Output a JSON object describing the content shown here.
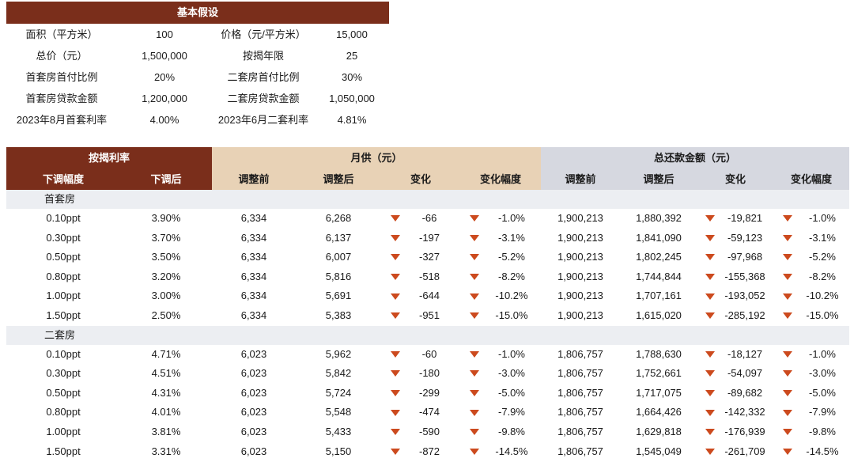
{
  "assumptions": {
    "title": "基本假设",
    "rows": [
      {
        "k1": "面积（平方米）",
        "v1": "100",
        "k2": "价格（元/平方米）",
        "v2": "15,000"
      },
      {
        "k1": "总价（元）",
        "v1": "1,500,000",
        "k2": "按揭年限",
        "v2": "25"
      },
      {
        "k1": "首套房首付比例",
        "v1": "20%",
        "k2": "二套房首付比例",
        "v2": "30%"
      },
      {
        "k1": "首套房贷款金额",
        "v1": "1,200,000",
        "k2": "二套房贷款金额",
        "v2": "1,050,000"
      },
      {
        "k1": "2023年8月首套利率",
        "v1": "4.00%",
        "k2": "2023年6月二套利率",
        "v2": "4.81%"
      }
    ]
  },
  "table": {
    "group_headers": {
      "rate": "按揭利率",
      "monthly": "月供（元）",
      "total": "总还款金额（元）"
    },
    "col_headers": [
      "下调幅度",
      "下调后",
      "调整前",
      "调整后",
      "变化",
      "变化幅度",
      "调整前",
      "调整后",
      "变化",
      "变化幅度"
    ],
    "colors": {
      "brown": "#7a2e1b",
      "tan": "#e8d2b6",
      "grey": "#d6d8e0",
      "down_arrow": "#cc4a1e"
    },
    "sections": [
      {
        "name": "首套房",
        "rows": [
          [
            "0.10ppt",
            "3.90%",
            "6,334",
            "6,268",
            "-66",
            "-1.0%",
            "1,900,213",
            "1,880,392",
            "-19,821",
            "-1.0%"
          ],
          [
            "0.30ppt",
            "3.70%",
            "6,334",
            "6,137",
            "-197",
            "-3.1%",
            "1,900,213",
            "1,841,090",
            "-59,123",
            "-3.1%"
          ],
          [
            "0.50ppt",
            "3.50%",
            "6,334",
            "6,007",
            "-327",
            "-5.2%",
            "1,900,213",
            "1,802,245",
            "-97,968",
            "-5.2%"
          ],
          [
            "0.80ppt",
            "3.20%",
            "6,334",
            "5,816",
            "-518",
            "-8.2%",
            "1,900,213",
            "1,744,844",
            "-155,368",
            "-8.2%"
          ],
          [
            "1.00ppt",
            "3.00%",
            "6,334",
            "5,691",
            "-644",
            "-10.2%",
            "1,900,213",
            "1,707,161",
            "-193,052",
            "-10.2%"
          ],
          [
            "1.50ppt",
            "2.50%",
            "6,334",
            "5,383",
            "-951",
            "-15.0%",
            "1,900,213",
            "1,615,020",
            "-285,192",
            "-15.0%"
          ]
        ]
      },
      {
        "name": "二套房",
        "rows": [
          [
            "0.10ppt",
            "4.71%",
            "6,023",
            "5,962",
            "-60",
            "-1.0%",
            "1,806,757",
            "1,788,630",
            "-18,127",
            "-1.0%"
          ],
          [
            "0.30ppt",
            "4.51%",
            "6,023",
            "5,842",
            "-180",
            "-3.0%",
            "1,806,757",
            "1,752,661",
            "-54,097",
            "-3.0%"
          ],
          [
            "0.50ppt",
            "4.31%",
            "6,023",
            "5,724",
            "-299",
            "-5.0%",
            "1,806,757",
            "1,717,075",
            "-89,682",
            "-5.0%"
          ],
          [
            "0.80ppt",
            "4.01%",
            "6,023",
            "5,548",
            "-474",
            "-7.9%",
            "1,806,757",
            "1,664,426",
            "-142,332",
            "-7.9%"
          ],
          [
            "1.00ppt",
            "3.81%",
            "6,023",
            "5,433",
            "-590",
            "-9.8%",
            "1,806,757",
            "1,629,818",
            "-176,939",
            "-9.8%"
          ],
          [
            "1.50ppt",
            "3.31%",
            "6,023",
            "5,150",
            "-872",
            "-14.5%",
            "1,806,757",
            "1,545,049",
            "-261,709",
            "-14.5%"
          ]
        ]
      }
    ]
  }
}
